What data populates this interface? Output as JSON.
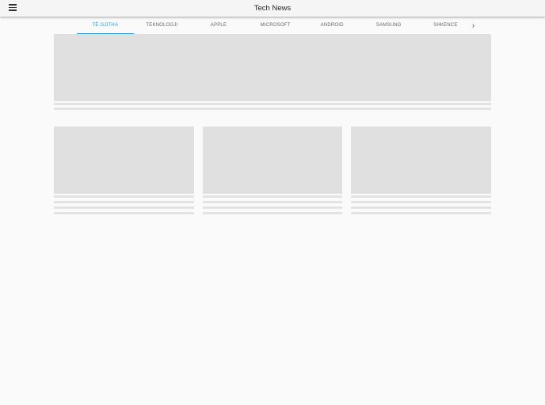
{
  "header": {
    "title": "Tech News",
    "menu_icon": "hamburger-icon"
  },
  "tabs": [
    {
      "label": "TË GJITHA",
      "active": true
    },
    {
      "label": "TEKNOLOGJI"
    },
    {
      "label": "APPLE"
    },
    {
      "label": "MICROSOFT"
    },
    {
      "label": "ANDROID"
    },
    {
      "label": "SAMSUNG"
    },
    {
      "label": "SHKENCE"
    }
  ],
  "tabs_more_icon": "chevron-right-icon",
  "colors": {
    "accent": "#2a9ad8",
    "skeleton": "#e0e0e0",
    "background": "#fafafa"
  }
}
